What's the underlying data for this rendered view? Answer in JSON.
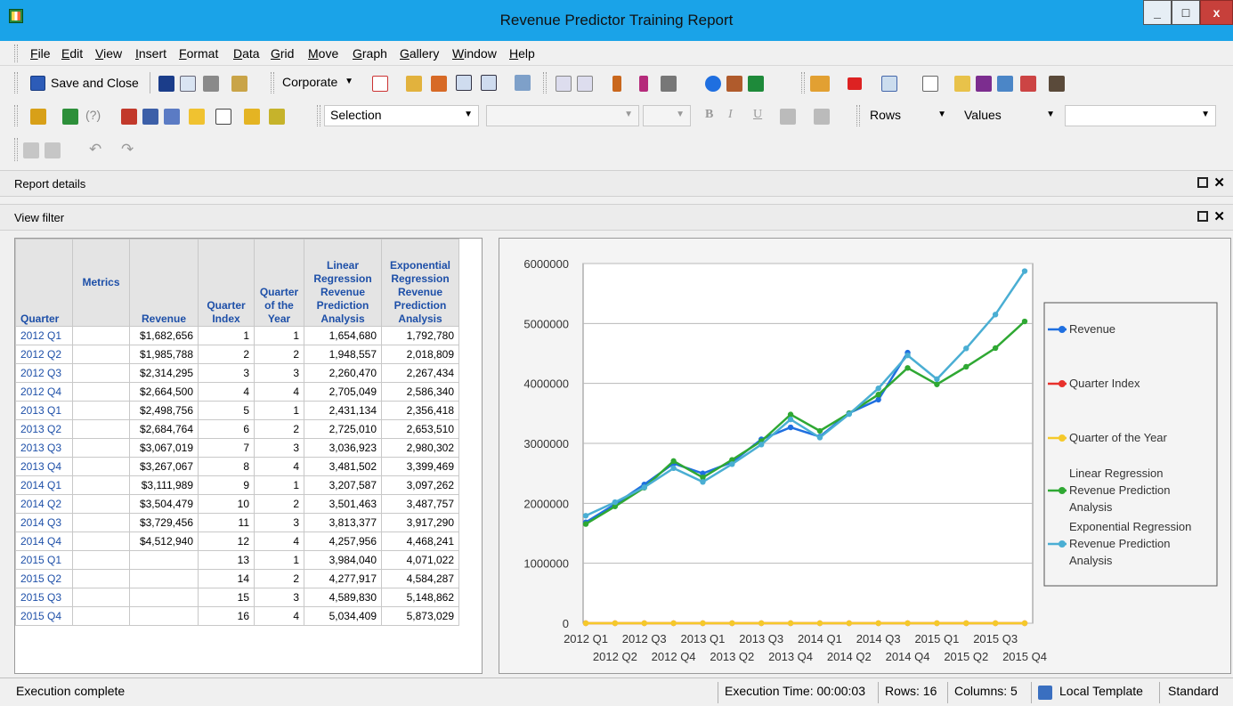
{
  "window": {
    "title": "Revenue Predictor Training Report",
    "min": "_",
    "max": "□",
    "close": "x"
  },
  "menu": [
    "File",
    "Edit",
    "View",
    "Insert",
    "Format",
    "Data",
    "Grid",
    "Move",
    "Graph",
    "Gallery",
    "Window",
    "Help"
  ],
  "toolbar": {
    "save_close": "Save and Close",
    "style_combo": "Corporate",
    "selection_combo": "Selection",
    "rows_combo": "Rows",
    "values_combo": "Values"
  },
  "sections": {
    "report_details": "Report details",
    "view_filter": "View filter"
  },
  "grid": {
    "headers": {
      "quarter": "Quarter",
      "metrics": "Metrics",
      "revenue": "Revenue",
      "quarter_index": "Quarter Index",
      "quarter_of_year": "Quarter of the Year",
      "linear": "Linear Regression Revenue Prediction Analysis",
      "exponential": "Exponential Regression Revenue Prediction Analysis"
    },
    "rows": [
      [
        "2012 Q1",
        "$1,682,656",
        "1",
        "1",
        "1,654,680",
        "1,792,780"
      ],
      [
        "2012 Q2",
        "$1,985,788",
        "2",
        "2",
        "1,948,557",
        "2,018,809"
      ],
      [
        "2012 Q3",
        "$2,314,295",
        "3",
        "3",
        "2,260,470",
        "2,267,434"
      ],
      [
        "2012 Q4",
        "$2,664,500",
        "4",
        "4",
        "2,705,049",
        "2,586,340"
      ],
      [
        "2013 Q1",
        "$2,498,756",
        "5",
        "1",
        "2,431,134",
        "2,356,418"
      ],
      [
        "2013 Q2",
        "$2,684,764",
        "6",
        "2",
        "2,725,010",
        "2,653,510"
      ],
      [
        "2013 Q3",
        "$3,067,019",
        "7",
        "3",
        "3,036,923",
        "2,980,302"
      ],
      [
        "2013 Q4",
        "$3,267,067",
        "8",
        "4",
        "3,481,502",
        "3,399,469"
      ],
      [
        "2014 Q1",
        "$3,111,989",
        "9",
        "1",
        "3,207,587",
        "3,097,262"
      ],
      [
        "2014 Q2",
        "$3,504,479",
        "10",
        "2",
        "3,501,463",
        "3,487,757"
      ],
      [
        "2014 Q3",
        "$3,729,456",
        "11",
        "3",
        "3,813,377",
        "3,917,290"
      ],
      [
        "2014 Q4",
        "$4,512,940",
        "12",
        "4",
        "4,257,956",
        "4,468,241"
      ],
      [
        "2015 Q1",
        "",
        "13",
        "1",
        "3,984,040",
        "4,071,022"
      ],
      [
        "2015 Q2",
        "",
        "14",
        "2",
        "4,277,917",
        "4,584,287"
      ],
      [
        "2015 Q3",
        "",
        "15",
        "3",
        "4,589,830",
        "5,148,862"
      ],
      [
        "2015 Q4",
        "",
        "16",
        "4",
        "5,034,409",
        "5,873,029"
      ]
    ]
  },
  "chart_data": {
    "type": "line",
    "categories": [
      "2012 Q1",
      "2012 Q2",
      "2012 Q3",
      "2012 Q4",
      "2013 Q1",
      "2013 Q2",
      "2013 Q3",
      "2013 Q4",
      "2014 Q1",
      "2014 Q2",
      "2014 Q3",
      "2014 Q4",
      "2015 Q1",
      "2015 Q2",
      "2015 Q3",
      "2015 Q4"
    ],
    "ylim": [
      0,
      6000000
    ],
    "yticks": [
      "0",
      "1000000",
      "2000000",
      "3000000",
      "4000000",
      "5000000",
      "6000000"
    ],
    "legend_position": "right",
    "series": [
      {
        "name": "Revenue",
        "color": "#1f6fe0",
        "values": [
          1682656,
          1985788,
          2314295,
          2664500,
          2498756,
          2684764,
          3067019,
          3267067,
          3111989,
          3504479,
          3729456,
          4512940,
          null,
          null,
          null,
          null
        ]
      },
      {
        "name": "Quarter Index",
        "color": "#e8312c",
        "values": [
          1,
          2,
          3,
          4,
          5,
          6,
          7,
          8,
          9,
          10,
          11,
          12,
          13,
          14,
          15,
          16
        ]
      },
      {
        "name": "Quarter of the Year",
        "color": "#f5c92a",
        "values": [
          1,
          2,
          3,
          4,
          1,
          2,
          3,
          4,
          1,
          2,
          3,
          4,
          1,
          2,
          3,
          4
        ]
      },
      {
        "name": "Linear Regression Revenue Prediction Analysis",
        "color": "#2fa833",
        "values": [
          1654680,
          1948557,
          2260470,
          2705049,
          2431134,
          2725010,
          3036923,
          3481502,
          3207587,
          3501463,
          3813377,
          4257956,
          3984040,
          4277917,
          4589830,
          5034409
        ]
      },
      {
        "name": "Exponential Regression Revenue Prediction Analysis",
        "color": "#4aaed3",
        "values": [
          1792780,
          2018809,
          2267434,
          2586340,
          2356418,
          2653510,
          2980302,
          3399469,
          3097262,
          3487757,
          3917290,
          4468241,
          4071022,
          4584287,
          5148862,
          5873029
        ]
      }
    ],
    "legend_lines": [
      [
        "Revenue"
      ],
      [
        "Quarter Index"
      ],
      [
        "Quarter of the Year"
      ],
      [
        "Linear Regression",
        "Revenue Prediction",
        "Analysis"
      ],
      [
        "Exponential Regression",
        "Revenue Prediction",
        "Analysis"
      ]
    ]
  },
  "status": {
    "message": "Execution complete",
    "exec_time": "Execution Time: 00:00:03",
    "rows": "Rows: 16",
    "columns": "Columns: 5",
    "template": "Local Template",
    "mode": "Standard"
  }
}
